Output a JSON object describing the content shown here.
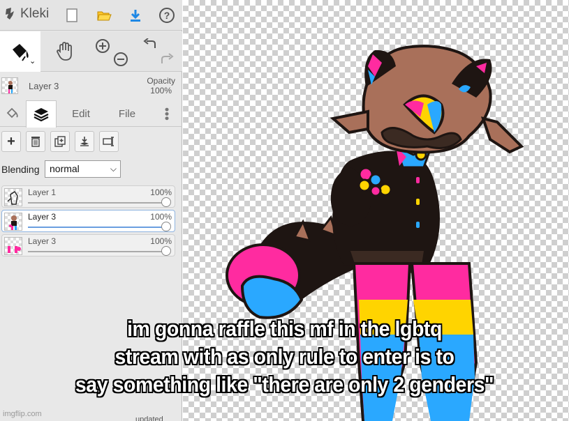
{
  "app": {
    "name": "Kleki"
  },
  "layer_header": {
    "name": "Layer 3",
    "opacity_label": "Opacity",
    "opacity_value": "100%"
  },
  "tabs": {
    "edit": "Edit",
    "file": "File"
  },
  "blending": {
    "label": "Blending",
    "value": "normal"
  },
  "layers": [
    {
      "name": "Layer 1",
      "opacity": "100%",
      "opacity_fraction": 1.0,
      "selected": false
    },
    {
      "name": "Layer 3",
      "opacity": "100%",
      "opacity_fraction": 1.0,
      "selected": true
    },
    {
      "name": "Layer 3",
      "opacity": "100%",
      "opacity_fraction": 1.0,
      "selected": false
    }
  ],
  "status": "updated",
  "caption": {
    "line1": "im gonna raffle this mf in the lgbtq",
    "line2": "stream with as only rule to enter is to",
    "line3": "say something like \"there are only 2 genders\""
  },
  "watermark": "imgflip.com",
  "colors": {
    "pink": "#ff2ba0",
    "yellow": "#ffd400",
    "blue": "#2aa8ff",
    "brown": "#a9705a",
    "dark": "#1e1512"
  },
  "icons": [
    "kleki-logo-icon",
    "new-file-icon",
    "open-folder-icon",
    "download-icon",
    "help-icon",
    "paint-bucket-icon",
    "hand-icon",
    "zoom-in-icon",
    "zoom-out-icon",
    "undo-icon",
    "redo-icon",
    "layers-icon",
    "more-icon",
    "add-layer-icon",
    "delete-layer-icon",
    "duplicate-layer-icon",
    "merge-down-icon",
    "rename-layer-icon"
  ]
}
